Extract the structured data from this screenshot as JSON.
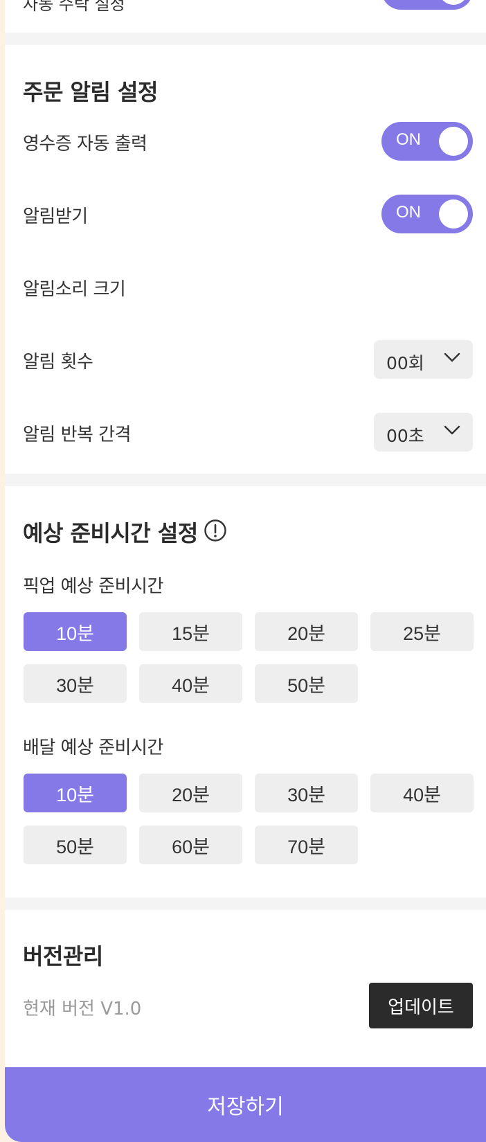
{
  "top_partial": {
    "label": "자동 수락 설정"
  },
  "order_alarm": {
    "title": "주문 알림 설정",
    "receipt_print": {
      "label": "영수증 자동 출력",
      "state": "ON"
    },
    "receive_alarm": {
      "label": "알림받기",
      "state": "ON"
    },
    "alarm_volume": {
      "label": "알림소리 크기"
    },
    "alarm_count": {
      "label": "알림 횟수",
      "value": "00회"
    },
    "alarm_interval": {
      "label": "알림 반복 간격",
      "value": "00초"
    }
  },
  "prep_time": {
    "title": "예상 준비시간 설정",
    "pickup": {
      "label": "픽업 예상 준비시간",
      "options": [
        "10분",
        "15분",
        "20분",
        "25분",
        "30분",
        "40분",
        "50분"
      ],
      "selected": "10분"
    },
    "delivery": {
      "label": "배달 예상 준비시간",
      "options": [
        "10분",
        "20분",
        "30분",
        "40분",
        "50분",
        "60분",
        "70분"
      ],
      "selected": "10분"
    }
  },
  "version": {
    "title": "버전관리",
    "current": "현재 버전 V1.0",
    "update_label": "업데이트"
  },
  "save_label": "저장하기",
  "colors": {
    "accent": "#8479e6",
    "chip_bg": "#eeeeee",
    "dark_button": "#2b2b2b"
  }
}
